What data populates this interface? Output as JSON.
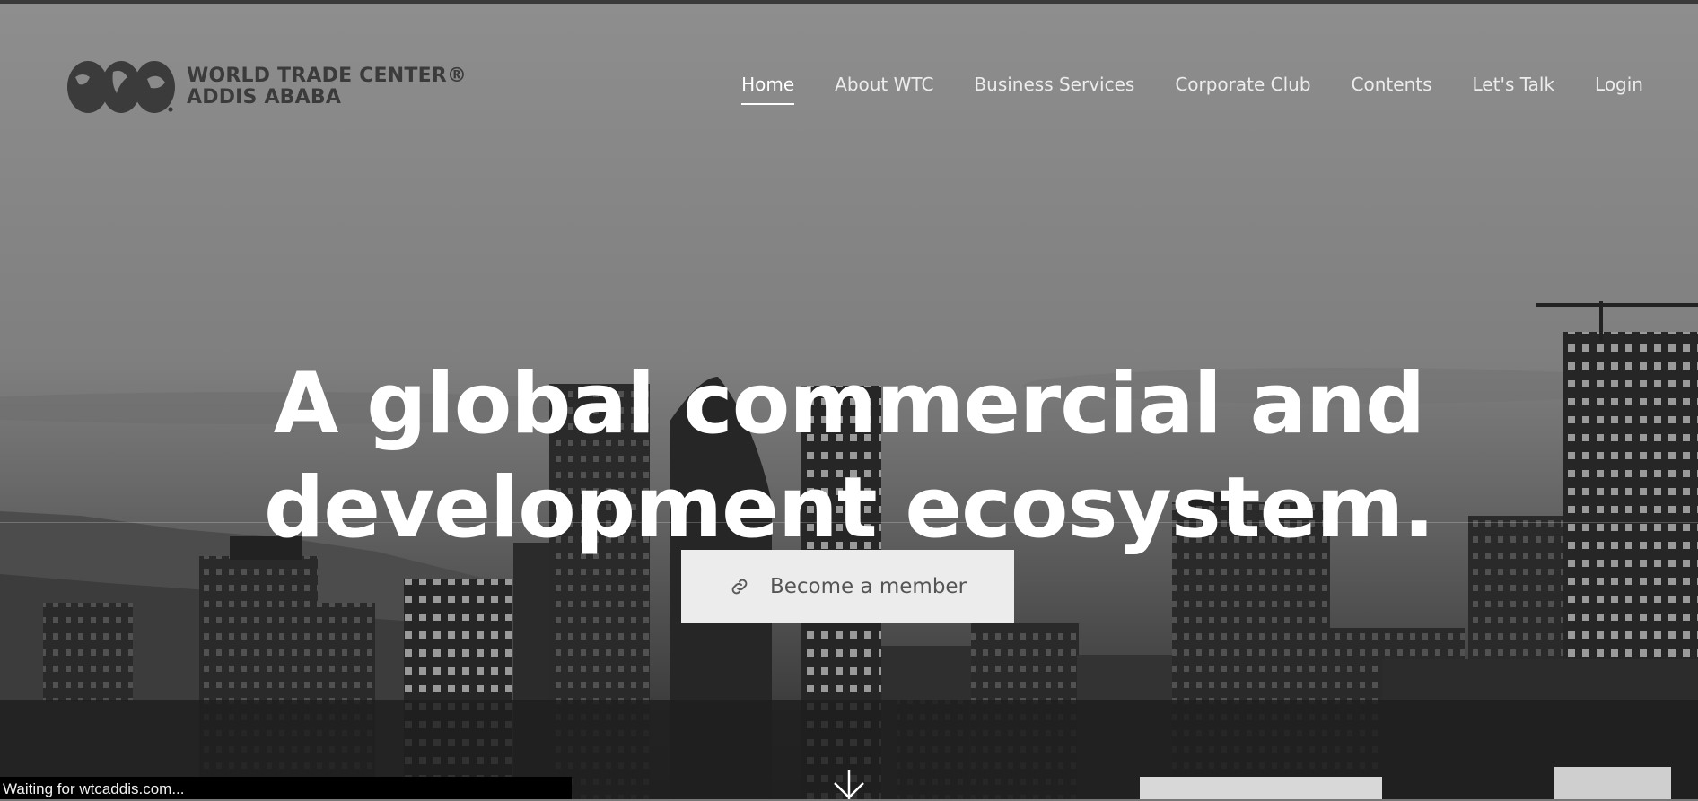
{
  "brand": {
    "line1": "WORLD TRADE CENTER®",
    "line2": "ADDIS ABABA"
  },
  "nav": {
    "items": [
      "Home",
      "About WTC",
      "Business Services",
      "Corporate Club",
      "Contents",
      "Let's Talk",
      "Login"
    ],
    "active": "Home"
  },
  "hero": {
    "headline_line1": "A global commercial and",
    "headline_line2": "development ecosystem.",
    "cta_label": "Become a member",
    "cta_icon": "link-icon",
    "scroll_icon": "arrow-down-icon"
  },
  "status": {
    "text": "Waiting for wtcaddis.com..."
  },
  "colors": {
    "logo_text": "#3b3b3b",
    "nav_text": "#ececec",
    "cta_bg": "#ececec",
    "cta_text": "#555555",
    "status_bg": "#000000"
  }
}
